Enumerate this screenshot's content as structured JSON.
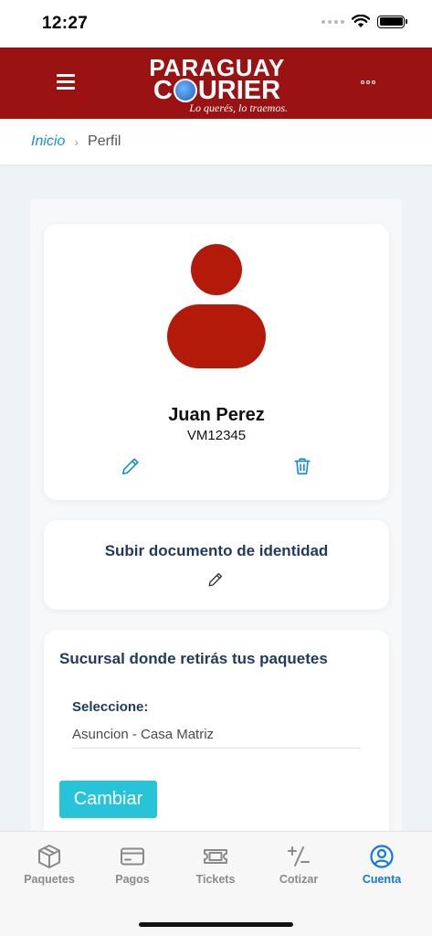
{
  "status_bar": {
    "time": "12:27"
  },
  "header": {
    "logo_line1": "PARAGUAY",
    "logo_line2_a": "C",
    "logo_line2_b": "URIER",
    "logo_tagline": "Lo querés, lo traemos."
  },
  "breadcrumb": {
    "home": "Inicio",
    "separator": "›",
    "current": "Perfil"
  },
  "profile": {
    "name": "Juan Perez",
    "id": "VM12345"
  },
  "document_card": {
    "title": "Subir documento de identidad"
  },
  "branch_card": {
    "title": "Sucursal donde retirás tus paquetes",
    "select_label": "Seleccione:",
    "selected_value": "Asuncion - Casa Matriz",
    "change_button": "Cambiar"
  },
  "tabs": [
    {
      "label": "Paquetes",
      "icon": "package-icon",
      "active": false
    },
    {
      "label": "Pagos",
      "icon": "card-icon",
      "active": false
    },
    {
      "label": "Tickets",
      "icon": "ticket-icon",
      "active": false
    },
    {
      "label": "Cotizar",
      "icon": "calculator-icon",
      "active": false
    },
    {
      "label": "Cuenta",
      "icon": "account-icon",
      "active": true
    }
  ],
  "colors": {
    "header_bg": "#9b1212",
    "avatar": "#b31a0a",
    "accent_blue": "#1277e6",
    "button_cyan": "#27c4d9",
    "link_blue": "#1a8fd0",
    "heading_navy": "#1e3a5f"
  }
}
